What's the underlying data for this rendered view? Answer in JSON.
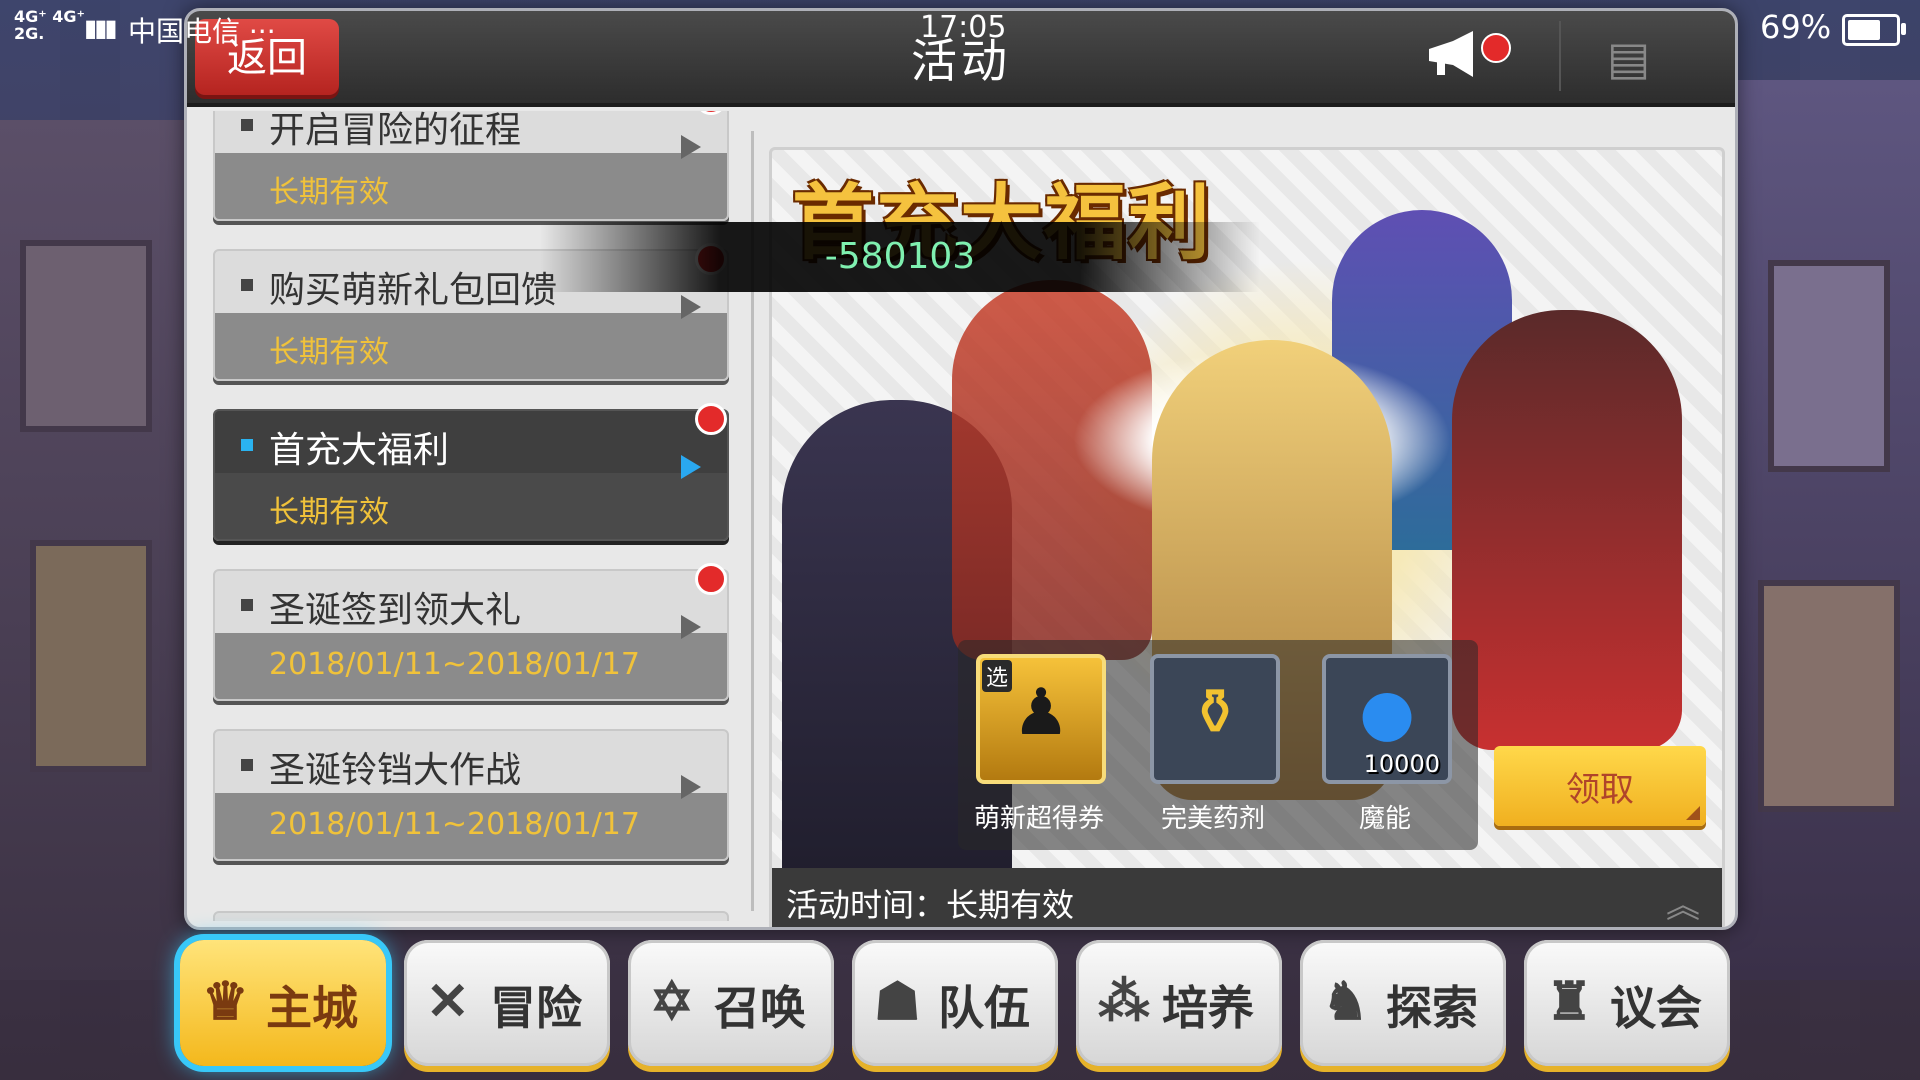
{
  "status_bar": {
    "network": "4G⁺ 4G⁺\n2G.",
    "carrier": "中国电信 ···",
    "time": "17:05",
    "battery": "69%",
    "battery_level": 0.69
  },
  "header": {
    "back_label": "返回",
    "title": "活动"
  },
  "events": [
    {
      "name": "开启冒险的征程",
      "period": "长期有效",
      "new": true,
      "active": false
    },
    {
      "name": "购买萌新礼包回馈",
      "period": "长期有效",
      "new": true,
      "active": false
    },
    {
      "name": "首充大福利",
      "period": "长期有效",
      "new": true,
      "active": true
    },
    {
      "name": "圣诞签到领大礼",
      "period": "2018/01/11~2018/01/17",
      "new": true,
      "active": false
    },
    {
      "name": "圣诞铃铛大作战",
      "period": "2018/01/11~2018/01/17",
      "new": false,
      "active": false
    }
  ],
  "banner": {
    "title": "首充大福利",
    "rewards": [
      {
        "label": "萌新超得券",
        "badge": "选",
        "count": "",
        "icon": "hero-silhouette-icon"
      },
      {
        "label": "完美药剂",
        "badge": "",
        "count": "",
        "icon": "potion-icon"
      },
      {
        "label": "魔能",
        "badge": "",
        "count": "10000",
        "icon": "mana-orb-icon"
      }
    ],
    "claim_label": "领取",
    "time_text": "活动时间：长期有效"
  },
  "overlay": {
    "text": "-580103"
  },
  "nav": [
    {
      "label": "主城",
      "icon": "castle-icon",
      "glyph": "♛",
      "active": true
    },
    {
      "label": "冒险",
      "icon": "crossed-swords-icon",
      "glyph": "✕",
      "active": false
    },
    {
      "label": "召唤",
      "icon": "hexagram-icon",
      "glyph": "✡",
      "active": false
    },
    {
      "label": "队伍",
      "icon": "team-icon",
      "glyph": "☗",
      "active": false
    },
    {
      "label": "培养",
      "icon": "triple-circle-icon",
      "glyph": "⁂",
      "active": false
    },
    {
      "label": "探索",
      "icon": "explorer-icon",
      "glyph": "♞",
      "active": false
    },
    {
      "label": "议会",
      "icon": "dragon-icon",
      "glyph": "♜",
      "active": false
    }
  ]
}
